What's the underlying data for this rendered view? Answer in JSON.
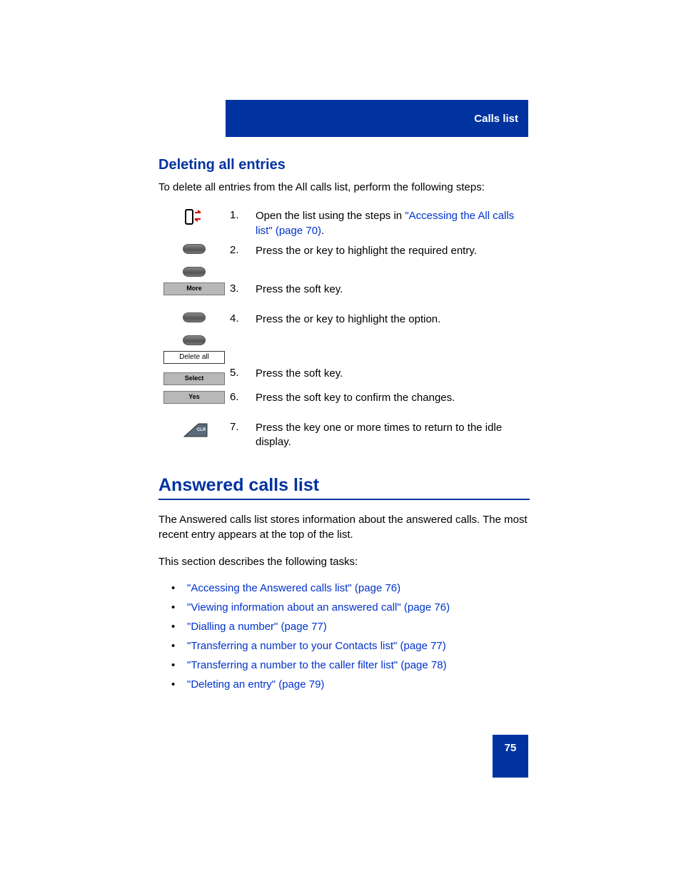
{
  "header": {
    "title": "Calls list"
  },
  "section1": {
    "heading": "Deleting all entries",
    "intro": "To delete all entries from the All calls list, perform the following steps:",
    "steps": [
      {
        "num": "1.",
        "pre": "Open the ",
        "link": "\"Accessing the All calls list\" (page 70)",
        "mid": " list using the steps in ",
        "post": "."
      },
      {
        "num": "2.",
        "text": "Press the        or         key to highlight the required entry."
      },
      {
        "num": "3.",
        "text": "Press the          soft key.",
        "button": "More"
      },
      {
        "num": "4.",
        "text": "Press the        or         key to highlight the             option.",
        "menu": "Delete all"
      },
      {
        "num": "5.",
        "text": "Press the            soft key.",
        "button": "Select"
      },
      {
        "num": "6.",
        "text": "Press the         soft key to confirm the changes.",
        "button": "Yes"
      },
      {
        "num": "7.",
        "text": "Press the        key one or more times to return to the idle display."
      }
    ]
  },
  "section2": {
    "heading": "Answered calls list",
    "para1": "The Answered calls list stores information about the answered calls. The most recent entry appears at the top of the list.",
    "para2": "This section describes the following tasks:",
    "links": [
      "\"Accessing the Answered calls list\" (page 76)",
      "\"Viewing information about an answered call\" (page 76)",
      "\"Dialling a number\" (page 77)",
      "\"Transferring a number to your Contacts list\" (page 77)",
      "\"Transferring a number to the caller filter list\" (page 78)",
      "\"Deleting an entry\" (page 79)"
    ]
  },
  "footer": {
    "page": "75"
  }
}
